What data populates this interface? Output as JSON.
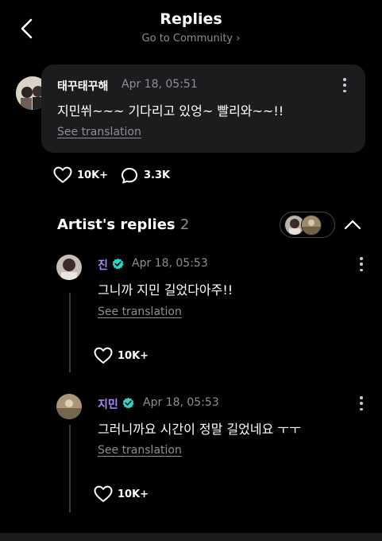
{
  "header": {
    "title": "Replies",
    "subtitle": "Go to Community ›"
  },
  "post": {
    "author": "태꾸태꾸해",
    "time": "Apr 18, 05:51",
    "text": "지민쒸~~~  기다리고 있엉~  빨리와~~!!",
    "translation_label": "See translation",
    "likes": "10K+",
    "comments": "3.3K"
  },
  "artist_section": {
    "title": "Artist's replies",
    "count": "2"
  },
  "replies": [
    {
      "author": "진",
      "time": "Apr 18, 05:53",
      "text": "그니까 지민 길었다아주!!",
      "translation_label": "See translation",
      "likes": "10K+"
    },
    {
      "author": "지민",
      "time": "Apr 18, 05:53",
      "text": "그러니까요 시간이 정말 길었네요 ㅜㅜ",
      "translation_label": "See translation",
      "likes": "10K+"
    }
  ],
  "colors": {
    "background": "#000000",
    "card": "#1c1c1e",
    "artist_name": "#a78bfa",
    "verified_badge": "#2fd4c8",
    "muted": "#8e8e93"
  },
  "icons": [
    "back-chevron-icon",
    "more-vertical-icon",
    "heart-icon",
    "comment-bubble-icon",
    "verified-badge-icon",
    "chevron-up-icon"
  ]
}
